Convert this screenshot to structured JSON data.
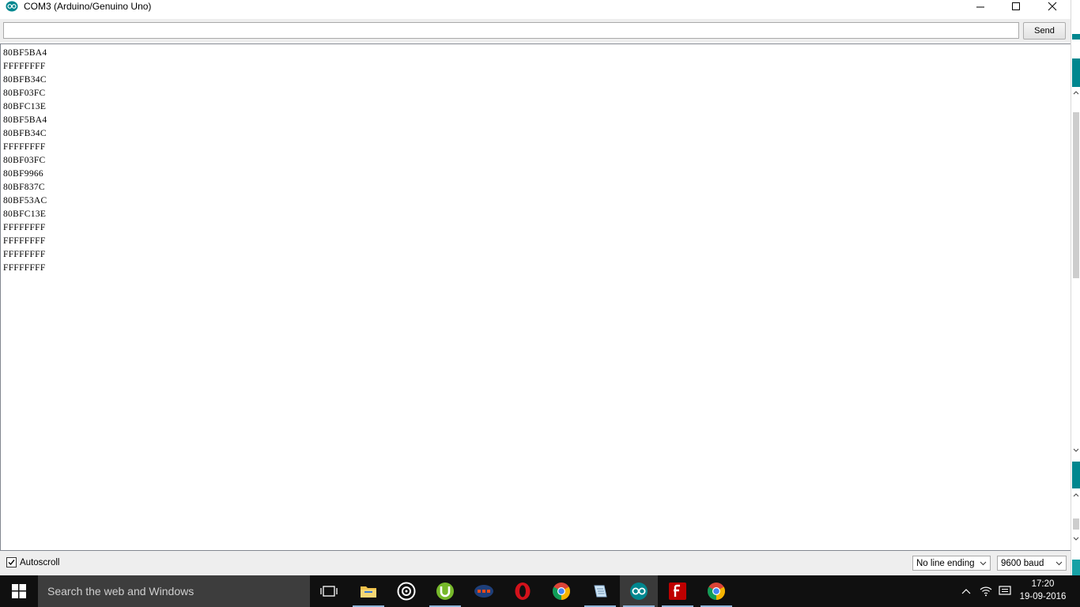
{
  "window": {
    "title": "COM3 (Arduino/Genuino Uno)"
  },
  "send_bar": {
    "input_value": "",
    "send_label": "Send"
  },
  "output_lines": [
    "80BF5BA4",
    "FFFFFFFF",
    "80BFB34C",
    "80BF03FC",
    "80BFC13E",
    "80BF5BA4",
    "80BFB34C",
    "FFFFFFFF",
    "80BF03FC",
    "80BF9966",
    "80BF837C",
    "80BF53AC",
    "80BFC13E",
    "FFFFFFFF",
    "FFFFFFFF",
    "FFFFFFFF",
    "FFFFFFFF"
  ],
  "bottom_bar": {
    "autoscroll_label": "Autoscroll",
    "autoscroll_checked": true,
    "line_ending_selected": "No line ending",
    "baud_selected": "9600 baud"
  },
  "taskbar": {
    "search_placeholder": "Search the web and Windows",
    "apps": [
      "task-view",
      "file-explorer",
      "media-player",
      "utorrent",
      "dfx-audio",
      "opera",
      "chrome",
      "notepad",
      "arduino",
      "filezilla",
      "chrome"
    ],
    "active_app": "arduino",
    "time": "17:20",
    "date": "19-09-2016"
  },
  "colors": {
    "arduino_teal": "#00878f",
    "taskbar_bg": "#101010",
    "search_bg": "#3d3d3d",
    "panel_bg": "#eeeeee"
  }
}
